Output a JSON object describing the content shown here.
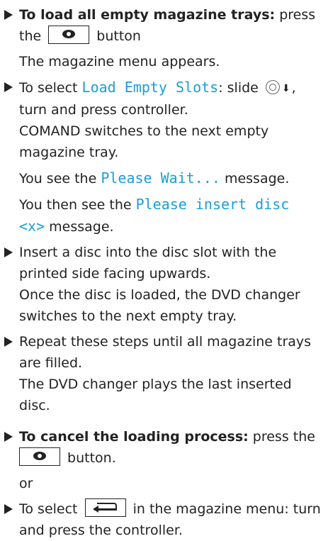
{
  "steps": [
    {
      "lead": "To load all empty magazine trays:",
      "text_a": " press",
      "text_b": "the",
      "text_c": " button",
      "result": "The magazine menu appears."
    },
    {
      "text_a": "To select ",
      "mono": "Load Empty Slots",
      "text_b": ": slide",
      "text_c": ",",
      "line2": "turn and press controller.",
      "result_1": "COMAND switches to the next empty",
      "result_2": "magazine tray.",
      "wait_a": "You see the ",
      "wait_mono": "Please Wait...",
      "wait_b": " message.",
      "insert_a": "You then see the ",
      "insert_mono_1": "Please insert disc",
      "insert_mono_2": "<x>",
      "insert_b": " message."
    },
    {
      "line1": "Insert a disc into the disc slot with the",
      "line2": "printed side facing upwards.",
      "line3": "Once the disc is loaded, the DVD changer",
      "line4": "switches to the next empty tray."
    },
    {
      "line1": "Repeat these steps until all magazine trays",
      "line2": "are filled.",
      "line3": "The DVD changer plays the last inserted",
      "line4": "disc."
    },
    {
      "lead": "To cancel the loading process:",
      "text_a": " press the",
      "text_b": " button."
    },
    {
      "or": "or"
    },
    {
      "text_a": "To select ",
      "text_b": " in the magazine menu: turn",
      "line2": "and press the controller."
    }
  ],
  "icons": {
    "disc_button": "disc-button-icon",
    "back_button": "back-button-icon",
    "controller": "controller-icon",
    "slide_down": "slide-down-arrow-icon",
    "bullet": "triangle-bullet-icon"
  },
  "colors": {
    "accent_mono": "#1a9ed9",
    "text": "#222222"
  }
}
